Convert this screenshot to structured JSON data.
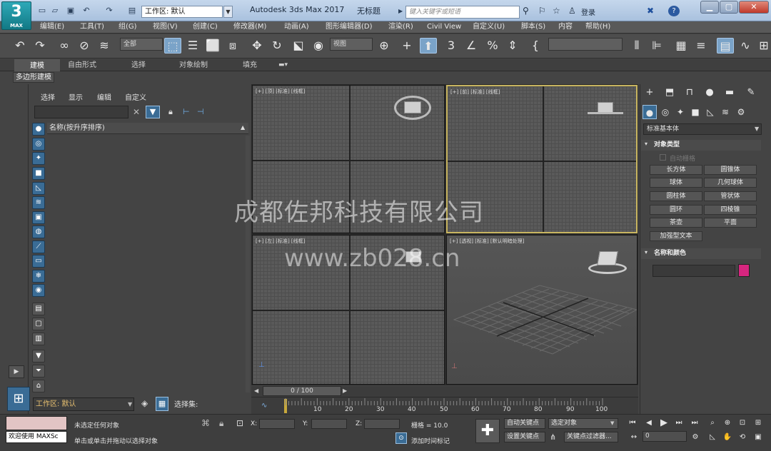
{
  "titlebar": {
    "workspace": "工作区: 默认",
    "app": "Autodesk 3ds Max 2017",
    "doc": "无标题",
    "search_placeholder": "键入关键字或短语",
    "login": "登录"
  },
  "logo": {
    "big": "3",
    "small": "MAX"
  },
  "menus": [
    "编辑(E)",
    "工具(T)",
    "组(G)",
    "视图(V)",
    "创建(C)",
    "修改器(M)",
    "动画(A)",
    "图形编辑器(D)",
    "渲染(R)",
    "Civil View",
    "自定义(U)",
    "脚本(S)",
    "内容",
    "帮助(H)"
  ],
  "toolbar": {
    "filter": "全部",
    "ref_coord": "视图"
  },
  "ribbon": {
    "tabs": [
      "建模",
      "自由形式",
      "选择",
      "对象绘制",
      "填充"
    ],
    "poly": "多边形建模"
  },
  "scene_explorer": {
    "menus": [
      "选择",
      "显示",
      "编辑",
      "自定义"
    ],
    "column": "名称(按升序排序)",
    "workspace": "工作区: 默认",
    "selset": "选择集:"
  },
  "viewports": {
    "top": "[+] [顶] [标准] [线框]",
    "front": "[+] [前] [标准] [线框]",
    "left": "[+] [左] [标准] [线框]",
    "persp": "[+] [透视] [标准] [默认明暗处理]"
  },
  "watermark": {
    "cn": "成都佐邦科技有限公司",
    "url": "www.zb028.cn"
  },
  "command_panel": {
    "dropdown": "标准基本体",
    "object_type": "对象类型",
    "autogrid": "自动栅格",
    "buttons": [
      "长方体",
      "圆锥体",
      "球体",
      "几何球体",
      "圆柱体",
      "管状体",
      "圆环",
      "四棱锥",
      "茶壶",
      "平面",
      "加强型文本"
    ],
    "name_color": "名称和颜色"
  },
  "timeline": {
    "pos": "0 / 100",
    "ticks": [
      "10",
      "20",
      "30",
      "40",
      "50",
      "60",
      "70",
      "80",
      "90",
      "100"
    ]
  },
  "status": {
    "welcome": "欢迎使用 MAXSc",
    "line1": "未选定任何对象",
    "line2": "单击或单击并拖动以选择对象",
    "x": "X:",
    "y": "Y:",
    "z": "Z:",
    "grid": "栅格 = 10.0",
    "add_tag": "添加时间标记",
    "autokey": "自动关键点",
    "setkey": "设置关键点",
    "sel_obj": "选定对象",
    "key_filter": "关键点过滤器...",
    "frame": "0"
  }
}
